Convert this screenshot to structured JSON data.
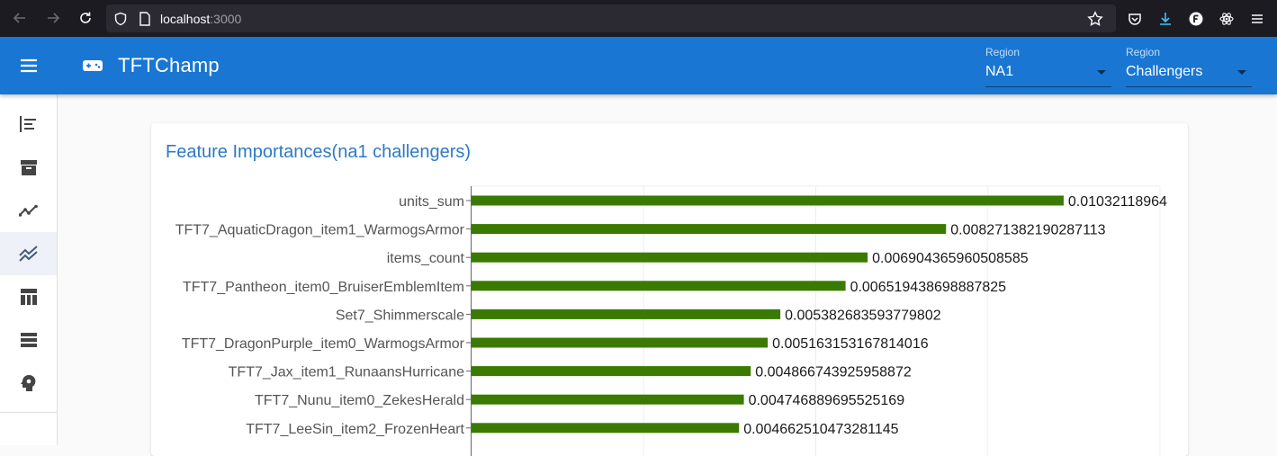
{
  "browser": {
    "url_host": "localhost",
    "url_port": ":3000"
  },
  "appbar": {
    "title": "TFTChamp",
    "region_select": {
      "label": "Region",
      "value": "NA1"
    },
    "tier_select": {
      "label": "Region",
      "value": "Challengers"
    }
  },
  "sidebar": {
    "items": [
      {
        "icon": "align-left-icon"
      },
      {
        "icon": "archive-icon"
      },
      {
        "icon": "trending-line-icon"
      },
      {
        "icon": "multiline-chart-icon",
        "active": true
      },
      {
        "icon": "table-icon"
      },
      {
        "icon": "list-icon"
      },
      {
        "icon": "psychology-icon"
      }
    ]
  },
  "card": {
    "title": "Feature Importances(na1 challengers)"
  },
  "chart_data": {
    "type": "bar",
    "orientation": "horizontal",
    "bar_color": "#3a7a00",
    "grid": true,
    "categories": [
      "units_sum",
      "TFT7_AquaticDragon_item1_WarmogsArmor",
      "items_count",
      "TFT7_Pantheon_item0_BruiserEmblemItem",
      "Set7_Shimmerscale",
      "TFT7_DragonPurple_item0_WarmogsArmor",
      "TFT7_Jax_item1_RunaansHurricane",
      "TFT7_Nunu_item0_ZekesHerald",
      "TFT7_LeeSin_item2_FrozenHeart"
    ],
    "values": [
      0.01032118964,
      0.008271382190287113,
      0.006904365960508585,
      0.006519438698887825,
      0.005382683593779802,
      0.005163153167814016,
      0.004866743925958872,
      0.004746889695525169,
      0.004662510473281145
    ],
    "data_labels": [
      "0.01032118964",
      "0.008271382190287113",
      "0.006904365960508585",
      "0.006519438698887825",
      "0.005382683593779802",
      "0.005163153167814016",
      "0.004866743925958872",
      "0.004746889695525169",
      "0.004662510473281145"
    ],
    "xlim": [
      0,
      0.012
    ]
  }
}
